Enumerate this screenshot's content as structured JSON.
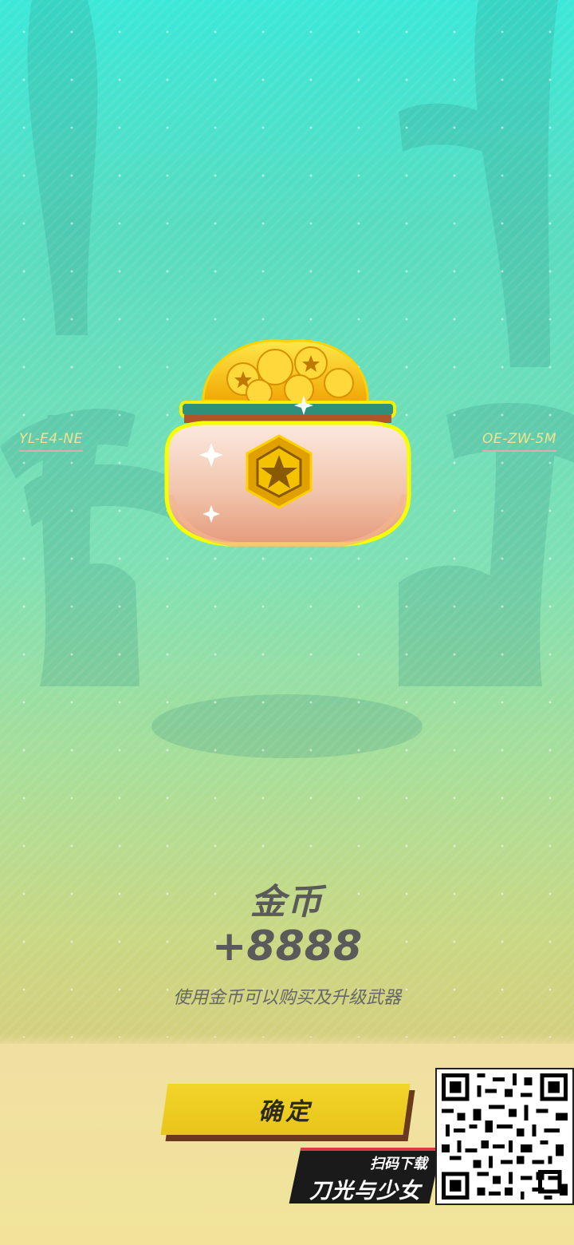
{
  "map_markers": {
    "left": "YL-E4-NE",
    "right": "OE-ZW-5M"
  },
  "reward": {
    "icon": "gold-coin-pot-icon",
    "name": "金币",
    "amount": "+8888",
    "description": "使用金币可以购买及升级武器"
  },
  "actions": {
    "confirm_label": "确定"
  },
  "promo": {
    "scan_label": "扫码下载",
    "game_name": "刀光与少女",
    "qr_icon": "qr-code-icon"
  },
  "colors": {
    "button": "#f3d42a",
    "text": "#5a5a5a",
    "top_bg": "#3be8d8",
    "bottom_bg": "#f0e39a"
  }
}
